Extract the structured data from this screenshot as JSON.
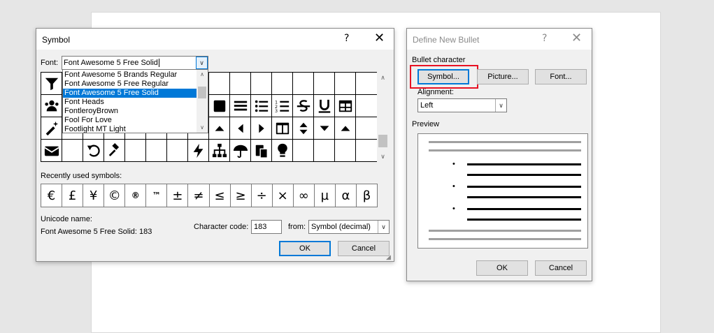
{
  "symbol_dialog": {
    "title": "Symbol",
    "help": "?",
    "close": "✕",
    "font_label": "Font:",
    "font_value": "Font Awesome 5 Free Solid",
    "font_list": [
      "Font Awesome 5 Brands Regular",
      "Font Awesome 5 Free Regular",
      "Font Awesome 5 Free Solid",
      "Font Heads",
      "FontleroyBrown",
      "Fool For Love",
      "Footlight MT Light"
    ],
    "selected_font_index": 2,
    "symbol_rows": [
      [
        "filter-icon",
        "",
        "",
        "",
        "",
        "",
        "",
        "",
        "",
        "",
        "",
        "",
        "",
        "",
        "",
        ""
      ],
      [
        "users-icon",
        "",
        "",
        "",
        "",
        "",
        "",
        "",
        "stop-icon",
        "align-justify-icon",
        "list-ul-icon",
        "list-ol-icon",
        "strikethrough-icon",
        "underline-icon",
        "table-icon",
        ""
      ],
      [
        "magic-icon",
        "",
        "",
        "",
        "",
        "",
        "",
        "",
        "caret-up-icon",
        "caret-left-icon",
        "caret-right-icon",
        "columns-icon",
        "sort-icon",
        "caret-down-icon",
        "caret-up-icon",
        ""
      ],
      [
        "envelope-icon",
        "",
        "undo-icon",
        "gavel-icon",
        "",
        "",
        "",
        "bolt-icon",
        "sitemap-icon",
        "umbrella-icon",
        "paste-icon",
        "lightbulb-icon",
        "",
        "",
        "",
        ""
      ]
    ],
    "recent_label": "Recently used symbols:",
    "recent_symbols": [
      "€",
      "£",
      "¥",
      "©",
      "®",
      "™",
      "±",
      "≠",
      "≤",
      "≥",
      "÷",
      "×",
      "∞",
      "µ",
      "α",
      "β"
    ],
    "unicode_name_label": "Unicode name:",
    "unicode_name_value": "Font Awesome 5 Free Solid: 183",
    "char_code_label": "Character code:",
    "char_code_value": "183",
    "from_label": "from:",
    "from_value": "Symbol (decimal)",
    "ok": "OK",
    "cancel": "Cancel"
  },
  "bullet_dialog": {
    "title": "Define New Bullet",
    "help": "?",
    "close": "✕",
    "bullet_character_label": "Bullet character",
    "symbol_button": "Symbol...",
    "picture_button": "Picture...",
    "font_button": "Font...",
    "alignment_label": "Alignment:",
    "alignment_value": "Left",
    "preview_label": "Preview",
    "bullet_glyph": "•",
    "ok": "OK",
    "cancel": "Cancel"
  },
  "colors": {
    "accent": "#0078d7",
    "highlight_red": "#e81123",
    "dialog_bg": "#f0f0f0"
  }
}
